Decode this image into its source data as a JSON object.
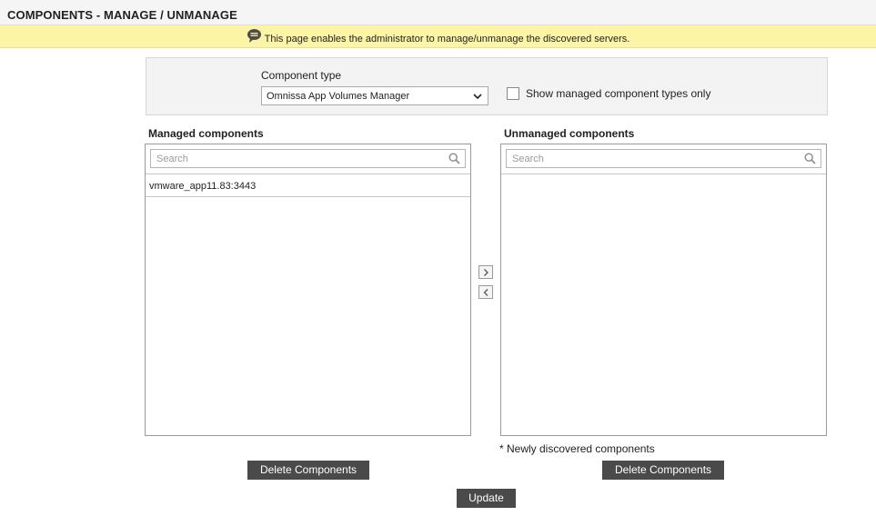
{
  "page": {
    "title": "COMPONENTS - MANAGE / UNMANAGE"
  },
  "info_bar": {
    "icon": "speech-bubble-icon",
    "message": "This page enables the administrator to manage/unmanage the discovered servers."
  },
  "component_type": {
    "label": "Component type",
    "selected": "Omnissa App Volumes Manager",
    "show_managed_only_label": "Show managed component types only",
    "show_managed_only_checked": false
  },
  "managed": {
    "title": "Managed components",
    "search_placeholder": "Search",
    "items": [
      "vmware_app11.83:3443"
    ]
  },
  "unmanaged": {
    "title": "Unmanaged components",
    "search_placeholder": "Search",
    "items": []
  },
  "move_buttons": {
    "move_right_icon": "chevron-right-icon",
    "move_left_icon": "chevron-left-icon"
  },
  "footnote": "* Newly discovered components",
  "buttons": {
    "delete_managed": "Delete Components",
    "delete_unmanaged": "Delete Components",
    "update": "Update"
  },
  "colors": {
    "info_bar_bg": "#fdf5a6",
    "button_bg": "#4a4a4a",
    "panel_bg": "#f3f3f3"
  }
}
